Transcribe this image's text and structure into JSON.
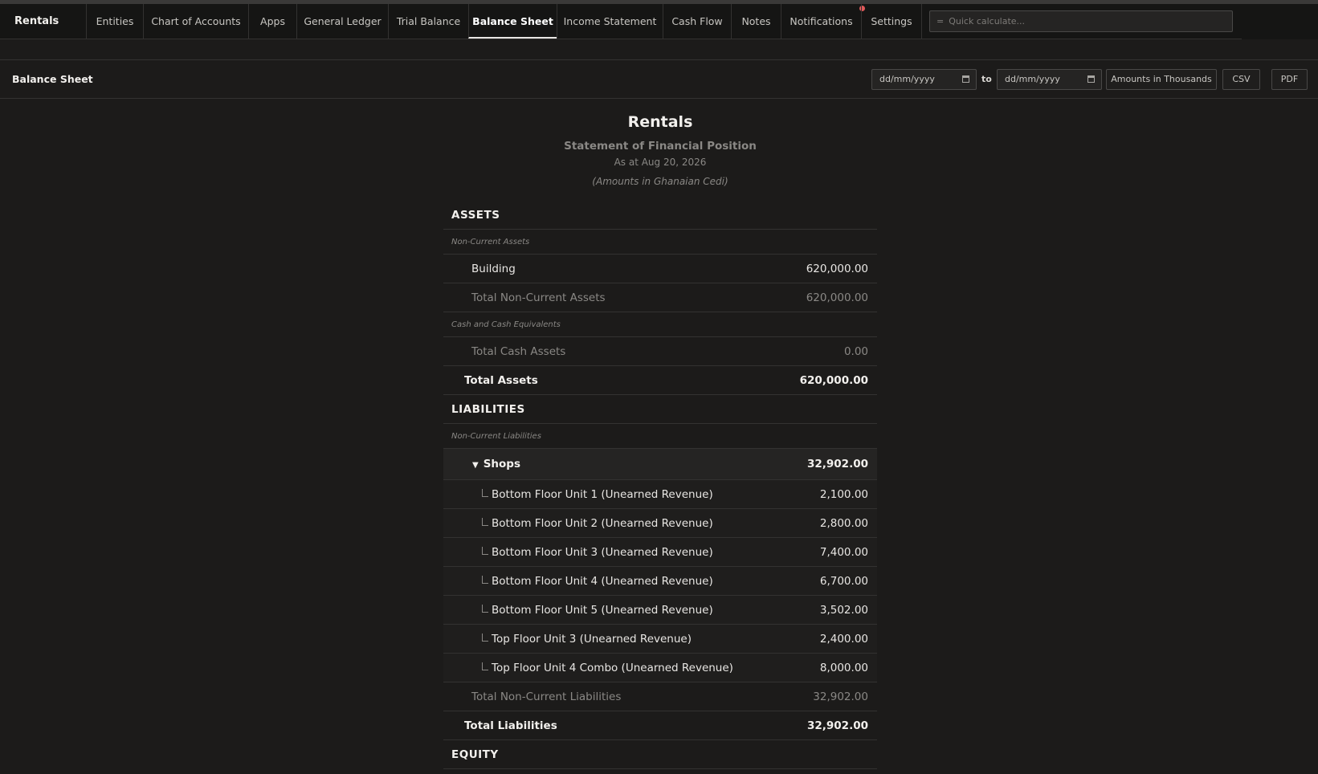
{
  "app": {
    "name": "Rentals"
  },
  "nav": {
    "tabs": [
      {
        "label": "Entities",
        "width": 71
      },
      {
        "label": "Chart of Accounts",
        "width": 131
      },
      {
        "label": "Apps",
        "width": 60
      },
      {
        "label": "General Ledger",
        "width": 114
      },
      {
        "label": "Trial Balance",
        "width": 100
      },
      {
        "label": "Balance Sheet",
        "width": 110
      },
      {
        "label": "Income Statement",
        "width": 132
      },
      {
        "label": "Cash Flow",
        "width": 85
      },
      {
        "label": "Notes",
        "width": 62
      },
      {
        "label": "Notifications",
        "width": 100
      },
      {
        "label": "Settings",
        "width": 76
      }
    ],
    "active_tab": "Balance Sheet",
    "quick_calc": {
      "symbol": "=",
      "placeholder": "Quick calculate..."
    }
  },
  "toolbar": {
    "title": "Balance Sheet",
    "date_from": "dd/mm/yyyy",
    "to_label": "to",
    "date_to": "dd/mm/yyyy",
    "amounts_button": "Amounts in Thousands",
    "csv_button": "CSV",
    "pdf_button": "PDF"
  },
  "report": {
    "company": "Rentals",
    "title": "Statement of Financial Position",
    "as_at": "As at Aug 20, 2026",
    "currency_note": "(Amounts in Ghanaian Cedi)",
    "assets": {
      "heading": "ASSETS",
      "non_current_label": "Non-Current Assets",
      "building": {
        "label": "Building",
        "amount": "620,000.00"
      },
      "total_non_current": {
        "label": "Total Non-Current Assets",
        "amount": "620,000.00"
      },
      "cash_label": "Cash and Cash Equivalents",
      "total_cash": {
        "label": "Total Cash Assets",
        "amount": "0.00"
      },
      "total": {
        "label": "Total Assets",
        "amount": "620,000.00"
      }
    },
    "liabilities": {
      "heading": "LIABILITIES",
      "non_current_label": "Non-Current Liabilities",
      "group": {
        "label": "Shops",
        "amount": "32,902.00",
        "toggle": "▼"
      },
      "children": [
        {
          "label": "Bottom Floor Unit 1 (Unearned Revenue)",
          "amount": "2,100.00"
        },
        {
          "label": "Bottom Floor Unit 2 (Unearned Revenue)",
          "amount": "2,800.00"
        },
        {
          "label": "Bottom Floor Unit 3 (Unearned Revenue)",
          "amount": "7,400.00"
        },
        {
          "label": "Bottom Floor Unit 4 (Unearned Revenue)",
          "amount": "6,700.00"
        },
        {
          "label": "Bottom Floor Unit 5 (Unearned Revenue)",
          "amount": "3,502.00"
        },
        {
          "label": "Top Floor Unit 3 (Unearned Revenue)",
          "amount": "2,400.00"
        },
        {
          "label": "Top Floor Unit 4 Combo (Unearned Revenue)",
          "amount": "8,000.00"
        }
      ],
      "total_non_current": {
        "label": "Total Non-Current Liabilities",
        "amount": "32,902.00"
      },
      "total": {
        "label": "Total Liabilities",
        "amount": "32,902.00"
      }
    },
    "equity": {
      "heading": "EQUITY"
    }
  }
}
